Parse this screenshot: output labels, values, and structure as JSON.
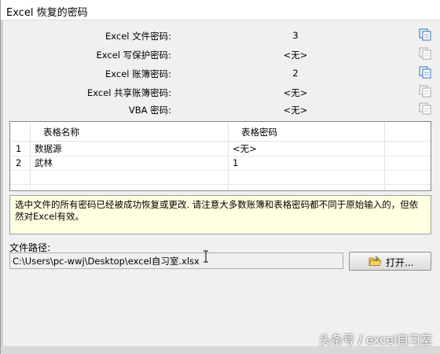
{
  "window": {
    "title": "Excel 恢复的密码"
  },
  "passwords": [
    {
      "label": "Excel 文件密码:",
      "value": "3"
    },
    {
      "label": "Excel 写保护密码:",
      "value": "<无>"
    },
    {
      "label": "Excel 账簿密码:",
      "value": "2"
    },
    {
      "label": "Excel 共享账簿密码:",
      "value": "<无>"
    },
    {
      "label": "VBA 密码:",
      "value": "<无>"
    }
  ],
  "sheet_table": {
    "headers": [
      "表格名称",
      "表格密码"
    ],
    "rows": [
      {
        "num": "1",
        "name": "数据源",
        "password": "<无>"
      },
      {
        "num": "2",
        "name": "武林",
        "password": "1"
      }
    ]
  },
  "message": "选中文件的所有密码已经被成功恢复或更改. 请注意大多数账簿和表格密码都不同于原始输入的，但依然对Excel有效。",
  "file_path": {
    "label": "文件路径:",
    "value": "C:\\Users\\pc-wwj\\Desktop\\excel自习室.xlsx"
  },
  "open_button": {
    "label": "打开..."
  },
  "watermark": "头条号 / excel自习室"
}
